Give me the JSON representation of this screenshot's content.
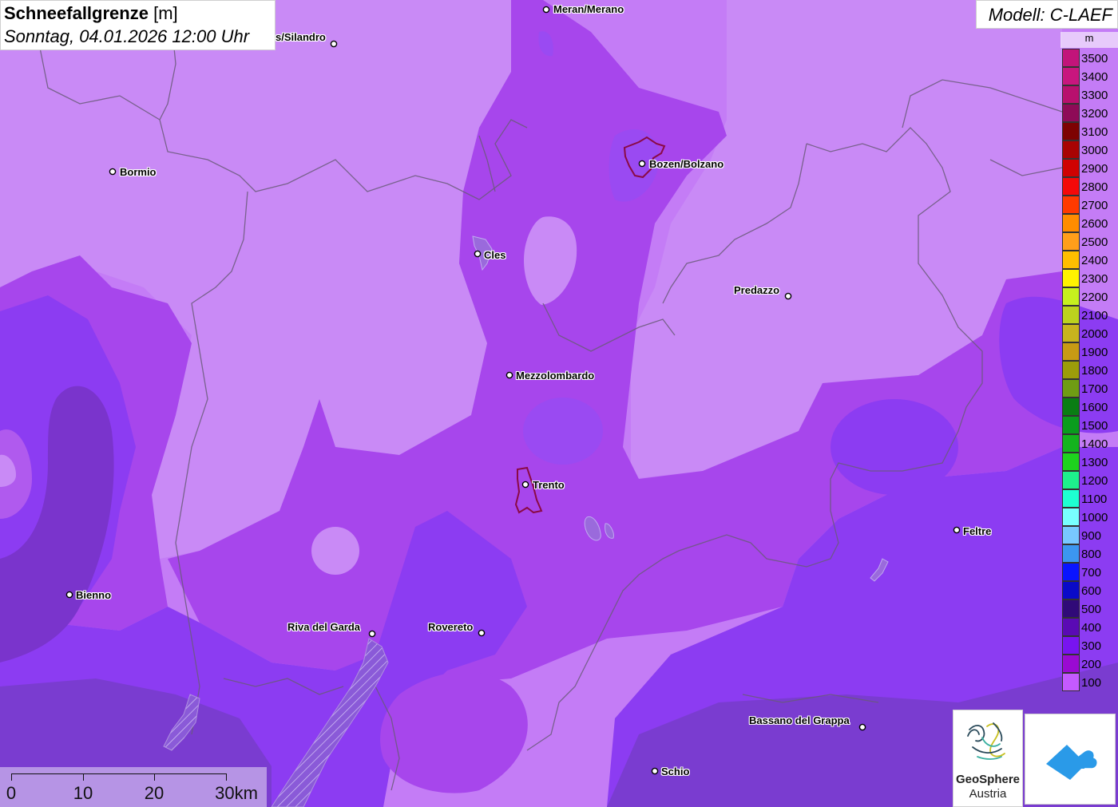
{
  "title": {
    "main": "Schneefallgrenze",
    "unit": "[m]",
    "subtitle": "Sonntag, 04.01.2026 12:00 Uhr"
  },
  "model": "Modell: C-LAEF",
  "legend": {
    "unit": "m",
    "items": [
      {
        "label": "3500",
        "color": "#c2147a"
      },
      {
        "label": "3400",
        "color": "#c8167e"
      },
      {
        "label": "3300",
        "color": "#b8106e"
      },
      {
        "label": "3200",
        "color": "#8e0b57"
      },
      {
        "label": "3100",
        "color": "#7d0202"
      },
      {
        "label": "3000",
        "color": "#a80303"
      },
      {
        "label": "2900",
        "color": "#cf0202"
      },
      {
        "label": "2800",
        "color": "#f40909"
      },
      {
        "label": "2700",
        "color": "#ff3a00"
      },
      {
        "label": "2600",
        "color": "#ff8c00"
      },
      {
        "label": "2500",
        "color": "#ff9e1a"
      },
      {
        "label": "2400",
        "color": "#ffbe00"
      },
      {
        "label": "2300",
        "color": "#fff200"
      },
      {
        "label": "2200",
        "color": "#c6f01e"
      },
      {
        "label": "2100",
        "color": "#bcd21e"
      },
      {
        "label": "2000",
        "color": "#c8b41e"
      },
      {
        "label": "1900",
        "color": "#c89a14"
      },
      {
        "label": "1800",
        "color": "#9c9c0a"
      },
      {
        "label": "1700",
        "color": "#6f9c14"
      },
      {
        "label": "1600",
        "color": "#0a7d14"
      },
      {
        "label": "1500",
        "color": "#0a9c1e"
      },
      {
        "label": "1400",
        "color": "#14b41e"
      },
      {
        "label": "1300",
        "color": "#1ed21e"
      },
      {
        "label": "1200",
        "color": "#1ef08c"
      },
      {
        "label": "1100",
        "color": "#1effd2"
      },
      {
        "label": "1000",
        "color": "#78ffff"
      },
      {
        "label": "900",
        "color": "#78c8ff"
      },
      {
        "label": "800",
        "color": "#3c96f0"
      },
      {
        "label": "700",
        "color": "#0a14ff"
      },
      {
        "label": "600",
        "color": "#0a0ac8"
      },
      {
        "label": "500",
        "color": "#300a78"
      },
      {
        "label": "400",
        "color": "#5a0ab4"
      },
      {
        "label": "300",
        "color": "#7814f0"
      },
      {
        "label": "200",
        "color": "#9a0ad2"
      },
      {
        "label": "100",
        "color": "#c45aff"
      }
    ]
  },
  "cities": [
    {
      "name": "Meran/Merano",
      "dot": [
        684,
        12
      ],
      "label": [
        693,
        4
      ]
    },
    {
      "name": "s/Silandro",
      "dot": [
        418,
        55
      ],
      "label": [
        345,
        39
      ]
    },
    {
      "name": "Bormio",
      "dot": [
        141,
        215
      ],
      "label": [
        150,
        208
      ]
    },
    {
      "name": "Bozen/Bolzano",
      "dot": [
        804,
        205
      ],
      "label": [
        813,
        198
      ]
    },
    {
      "name": "Cles",
      "dot": [
        598,
        318
      ],
      "label": [
        606,
        312
      ]
    },
    {
      "name": "Predazzo",
      "dot": [
        987,
        371
      ],
      "label": [
        919,
        356
      ]
    },
    {
      "name": "Mezzolombardo",
      "dot": [
        638,
        470
      ],
      "label": [
        646,
        463
      ]
    },
    {
      "name": "Trento",
      "dot": [
        658,
        607
      ],
      "label": [
        667,
        600
      ]
    },
    {
      "name": "Feltre",
      "dot": [
        1198,
        664
      ],
      "label": [
        1206,
        658
      ]
    },
    {
      "name": "Bienno",
      "dot": [
        87,
        745
      ],
      "label": [
        95,
        738
      ]
    },
    {
      "name": "Riva del Garda",
      "dot": [
        466,
        794
      ],
      "label": [
        360,
        778
      ]
    },
    {
      "name": "Rovereto",
      "dot": [
        603,
        793
      ],
      "label": [
        536,
        778
      ]
    },
    {
      "name": "Bassano del Grappa",
      "dot": [
        1080,
        911
      ],
      "label": [
        938,
        895
      ]
    },
    {
      "name": "Schio",
      "dot": [
        820,
        966
      ],
      "label": [
        828,
        959
      ]
    }
  ],
  "scalebar": {
    "labels": [
      "0",
      "10",
      "20",
      "30km"
    ]
  },
  "logos": {
    "geosphere_line1": "GeoSphere",
    "geosphere_line2": "Austria"
  }
}
